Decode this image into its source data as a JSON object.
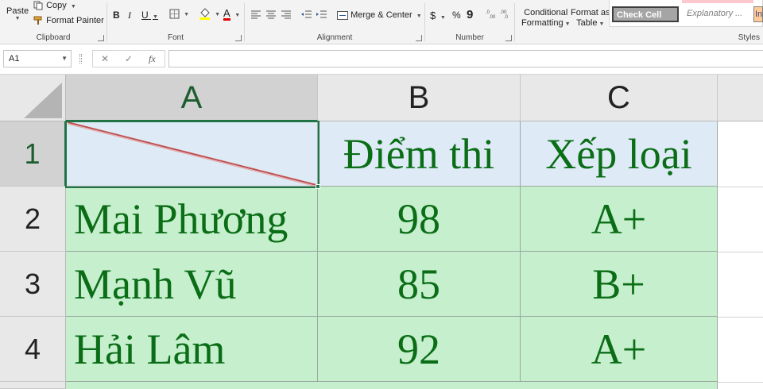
{
  "ribbon": {
    "clipboard": {
      "paste_label": "Paste",
      "copy_label": "Copy",
      "format_painter_label": "Format Painter",
      "group_label": "Clipboard"
    },
    "font": {
      "bold": "B",
      "italic": "I",
      "underline": "U",
      "font_color_letter": "A",
      "group_label": "Font"
    },
    "alignment": {
      "merge_label": "Merge & Center",
      "group_label": "Alignment"
    },
    "number": {
      "currency": "$",
      "percent": "%",
      "comma": "9",
      "group_label": "Number"
    },
    "styles": {
      "conditional_line1": "Conditional",
      "conditional_line2": "Formatting",
      "format_table_line1": "Format as",
      "format_table_line2": "Table",
      "check_cell": "Check Cell",
      "explanatory": "Explanatory ...",
      "input_partial": "In",
      "group_label": "Styles"
    }
  },
  "formula_bar": {
    "name_box": "A1",
    "cancel_symbol": "✕",
    "enter_symbol": "✓",
    "fx_symbol": "fx",
    "formula_value": ""
  },
  "sheet": {
    "columns": [
      "A",
      "B",
      "C"
    ],
    "rows": [
      "1",
      "2",
      "3",
      "4"
    ],
    "header_row": {
      "a1": "",
      "b1": "Điểm thi",
      "c1": "Xếp loại"
    },
    "data_rows": [
      {
        "name": "Mai Phương",
        "score": "98",
        "grade": "A+"
      },
      {
        "name": "Mạnh Vũ",
        "score": "85",
        "grade": "B+"
      },
      {
        "name": "Hải Lâm",
        "score": "92",
        "grade": "A+"
      }
    ],
    "colors": {
      "header_fill": "#deebf7",
      "body_fill": "#c6efce",
      "text_green": "#0b6e17",
      "diagonal_line": "#c0504d",
      "selection": "#217346"
    }
  }
}
